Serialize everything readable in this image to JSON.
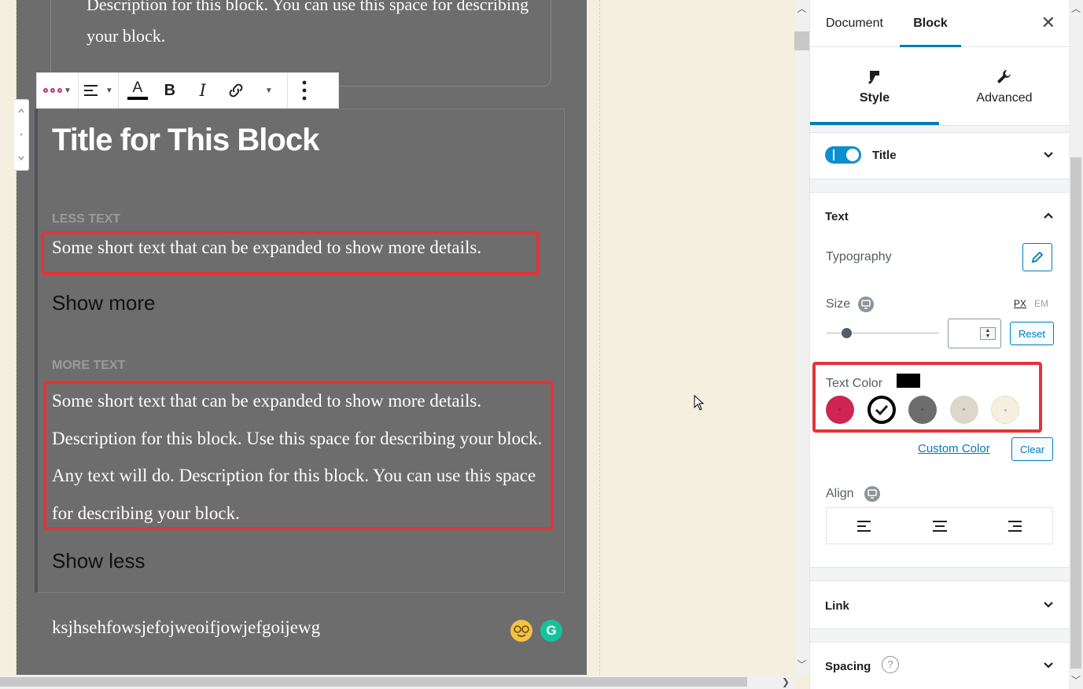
{
  "editor": {
    "previous_block_text": "Description for this block. You can use this space for describing your block.",
    "block_title": "Title for This Block",
    "less_label": "LESS TEXT",
    "less_text": "Some short text that can be expanded to show more details.",
    "show_more": "Show more",
    "more_label": "MORE TEXT",
    "more_text": "Some short text that can be expanded to show more details. Description for this block. Use this space for describing your block. Any text will do. Description for this block. You can use this space for describing your block.",
    "show_less": "Show less",
    "bottom_paragraph": "ksjhsehfowsjefojweoifjowjefgoijewg",
    "grammarly_letter": "G"
  },
  "toolbar": {
    "icons": [
      "block-type-icon",
      "align-left-icon",
      "text-color-icon",
      "bold-icon",
      "italic-icon",
      "link-icon",
      "more-caret-icon",
      "kebab-menu-icon"
    ],
    "text_color_letter": "A",
    "bold_letter": "B",
    "italic_letter": "I"
  },
  "sidebar": {
    "tabs": {
      "document": "Document",
      "block": "Block"
    },
    "close_glyph": "✕",
    "subtabs": {
      "style": "Style",
      "advanced": "Advanced"
    },
    "title_panel": {
      "label": "Title",
      "enabled": true
    },
    "text_panel": {
      "label": "Text",
      "typography_label": "Typography",
      "size_label": "Size",
      "unit_px": "PX",
      "unit_em": "EM",
      "size_value": "",
      "reset_label": "Reset",
      "text_color_label": "Text Color",
      "selected_color": "#000000",
      "swatches": [
        {
          "name": "swatch-crimson",
          "color": "#cd2653"
        },
        {
          "name": "swatch-black",
          "color": "#000000",
          "selected": true
        },
        {
          "name": "swatch-dark-gray",
          "color": "#6d6d6d"
        },
        {
          "name": "swatch-light-gray",
          "color": "#dcd7ca"
        },
        {
          "name": "swatch-cream",
          "color": "#f5efe0"
        }
      ],
      "custom_color_label": "Custom Color",
      "clear_label": "Clear",
      "align_label": "Align"
    },
    "link_panel": {
      "label": "Link"
    },
    "spacing_panel": {
      "label": "Spacing",
      "help_glyph": "?"
    }
  },
  "colors": {
    "accent": "#007cba",
    "highlight": "#e2343a",
    "toggle": "#0d8ecf",
    "canvas_dark": "#6d6d6d",
    "canvas_bg": "#f5efe0"
  }
}
